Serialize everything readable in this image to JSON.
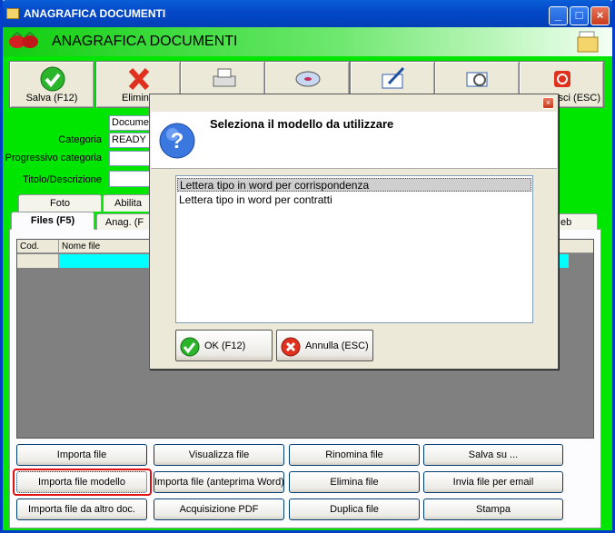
{
  "window": {
    "title": "ANAGRAFICA DOCUMENTI",
    "header_title": "ANAGRAFICA DOCUMENTI"
  },
  "toolbar": {
    "save_label": "Salva (F12)",
    "delete_label": "Elimina",
    "exit_label": "Esci (ESC)"
  },
  "form": {
    "document_value": "Documen",
    "category_label": "Categoria",
    "category_value": "READY",
    "progressive_label": "Progressivo categoria",
    "title_label": "Titolo/Descrizione"
  },
  "tabs": {
    "foto": "Foto",
    "abilita": "Abilita",
    "files": "Files (F5)",
    "anag": "Anag. (F",
    "web": "eb"
  },
  "grid": {
    "col_cod": "Cod.",
    "col_nome": "Nome file"
  },
  "buttons": {
    "importa_file": "Importa file",
    "visualizza_file": "Visualizza file",
    "rinomina_file": "Rinomina file",
    "salva_su": "Salva su ...",
    "importa_modello": "Importa file modello",
    "importa_anteprima": "Importa file (anteprima Word)",
    "elimina_file": "Elimina file",
    "invia_email": "Invia file per email",
    "importa_altro": "Importa file da altro doc.",
    "acquisizione_pdf": "Acquisizione PDF",
    "duplica_file": "Duplica file",
    "stampa": "Stampa"
  },
  "dialog": {
    "title": "Seleziona il modello da utilizzare",
    "items": [
      "Lettera tipo in word per corrispondenza",
      "Lettera tipo in word per contratti"
    ],
    "ok_label": "OK (F12)",
    "cancel_label": "Annulla (ESC)"
  },
  "icons": {
    "app": "folder-icon",
    "header": "strawberries-icon",
    "help": "question-icon",
    "ok": "check-icon",
    "cancel": "x-icon"
  },
  "colors": {
    "accent_green": "#00e600",
    "highlight_red": "#e01010",
    "grid_row_cyan": "#00ffff"
  }
}
